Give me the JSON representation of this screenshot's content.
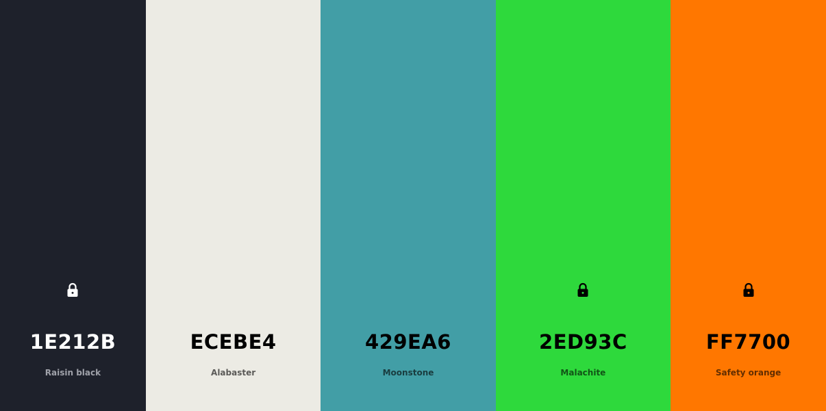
{
  "palette": {
    "colors": [
      {
        "hex_label": "1E212B",
        "name": "Raisin black",
        "bg": "#1E212B",
        "locked": true,
        "lock_color": "#ffffff",
        "theme": "dark"
      },
      {
        "hex_label": "ECEBE4",
        "name": "Alabaster",
        "bg": "#ECEBE4",
        "locked": false,
        "lock_color": "#000000",
        "theme": "light"
      },
      {
        "hex_label": "429EA6",
        "name": "Moonstone",
        "bg": "#429EA6",
        "locked": false,
        "lock_color": "#000000",
        "theme": "light"
      },
      {
        "hex_label": "2ED93C",
        "name": "Malachite",
        "bg": "#2ED93C",
        "locked": true,
        "lock_color": "#000000",
        "theme": "light"
      },
      {
        "hex_label": "FF7700",
        "name": "Safety orange",
        "bg": "#FF7700",
        "locked": true,
        "lock_color": "#000000",
        "theme": "light"
      }
    ]
  }
}
